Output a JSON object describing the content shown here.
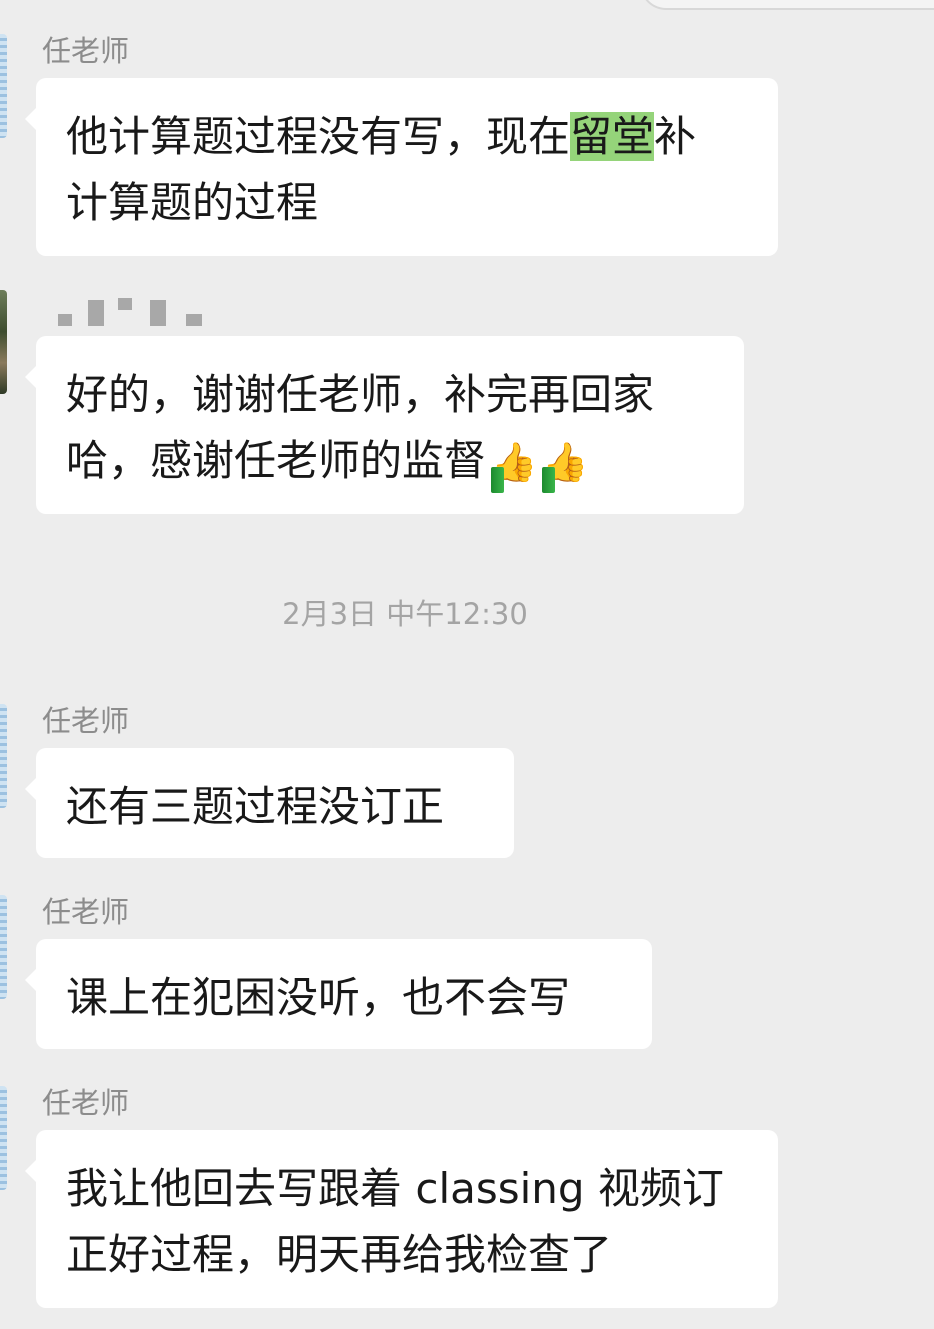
{
  "chat": {
    "timestamp": "2月3日 中午12:30",
    "messages": [
      {
        "sender": "任老师",
        "lines": [
          {
            "before": "他计算题过程没有写，现在",
            "highlight": "留堂",
            "after": "补"
          },
          {
            "text": "计算题的过程"
          }
        ]
      },
      {
        "sender": "",
        "lines": [
          {
            "text": "好的，谢谢任老师，补完再回家"
          },
          {
            "text": "哈，感谢任老师的监督"
          }
        ],
        "emoji": [
          "thumbs-up-icon",
          "thumbs-up-icon"
        ]
      },
      {
        "sender": "任老师",
        "lines": [
          {
            "text": "还有三题过程没订正"
          }
        ]
      },
      {
        "sender": "任老师",
        "lines": [
          {
            "text": "课上在犯困没听，也不会写"
          }
        ]
      },
      {
        "sender": "任老师",
        "lines": [
          {
            "text": "我让他回去写跟着 classing 视频订"
          },
          {
            "text": "正好过程，明天再给我检查了"
          }
        ]
      }
    ]
  },
  "colors": {
    "background": "#ededed",
    "bubble": "#ffffff",
    "highlight": "#95d47a",
    "sender_text": "#8c8c8c",
    "timestamp_text": "#a4a4a4"
  }
}
